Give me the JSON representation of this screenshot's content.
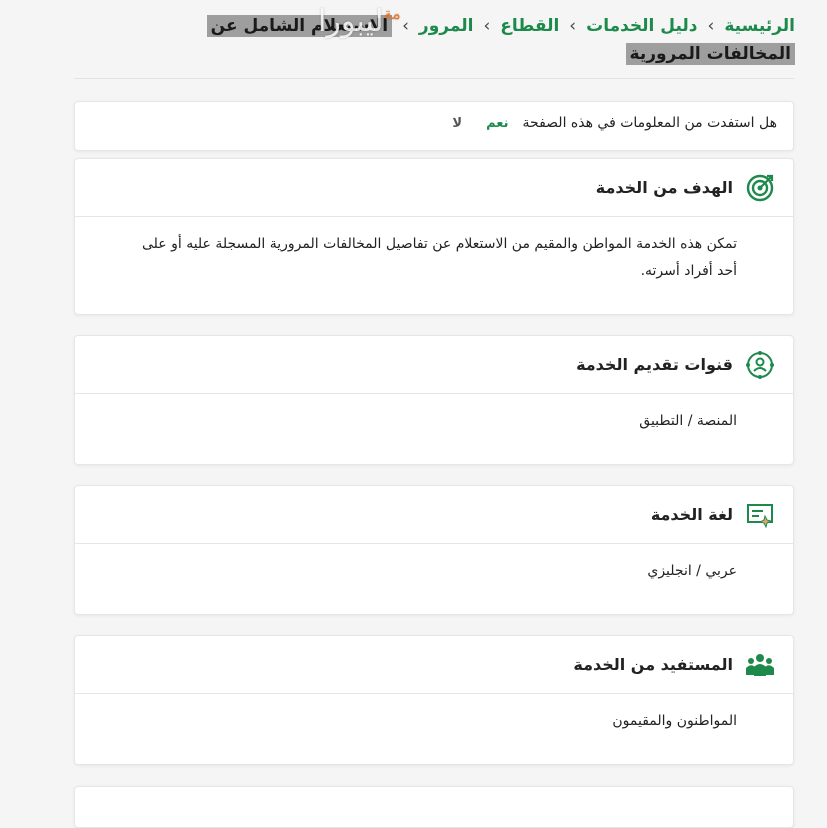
{
  "breadcrumb": {
    "home": "الرئيسية",
    "services": "دليل الخدمات",
    "sector": "القطاع",
    "traffic": "المرور",
    "current": "الاستعلام الشامل عن المخالفات المرورية",
    "separator": "›"
  },
  "watermark": {
    "text": "ليبورا",
    "suffix": "مة"
  },
  "feedback": {
    "question": "هل استفدت من المعلومات في هذه الصفحة",
    "yes": "نعم",
    "no": "لا"
  },
  "sections": [
    {
      "title": "الهدف من الخدمة",
      "icon": "target-icon",
      "body": "تمكن هذه الخدمة المواطن والمقيم من الاستعلام عن تفاصيل المخالفات المرورية المسجلة عليه أو على أحد أفراد أسرته."
    },
    {
      "title": "قنوات تقديم الخدمة",
      "icon": "channels-icon",
      "body": "المنصة / التطبيق"
    },
    {
      "title": "لغة الخدمة",
      "icon": "language-icon",
      "body": "عربي / انجليزي"
    },
    {
      "title": "المستفيد من الخدمة",
      "icon": "beneficiaries-icon",
      "body": "المواطنون والمقيمون"
    }
  ],
  "colors": {
    "accent": "#1d8a4c",
    "highlight": "#9e9e9e"
  }
}
